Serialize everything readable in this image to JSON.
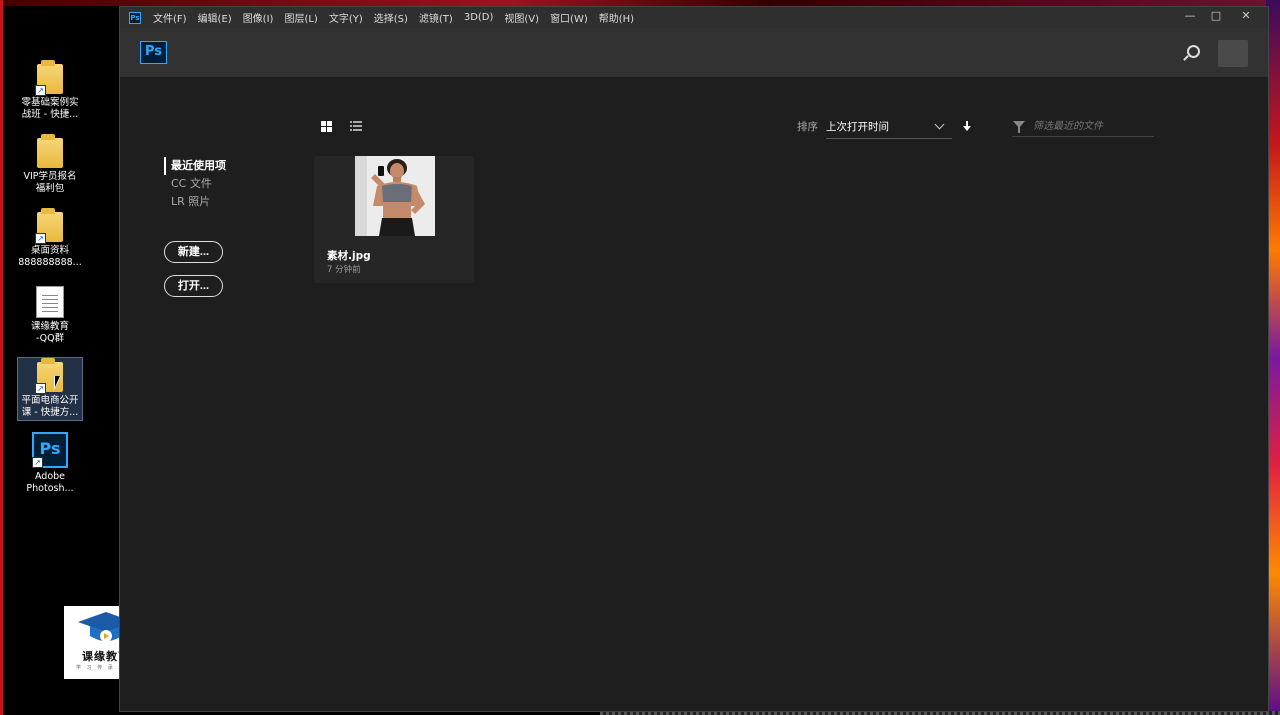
{
  "desktop": {
    "icons": [
      {
        "name": "零基础案例实战班 - 快捷...",
        "line1": "零基础案例实",
        "line2": "战班 - 快捷...",
        "type": "folder",
        "shortcut": true
      },
      {
        "name": "VIP学员报名福利包",
        "line1": "VIP学员报名",
        "line2": "福利包",
        "type": "folder",
        "shortcut": false
      },
      {
        "name": "桌面资料888888888...",
        "line1": "桌面资料",
        "line2": "888888888...",
        "type": "folder",
        "shortcut": true
      },
      {
        "name": "课缘教育-QQ群",
        "line1": "课缘教育",
        "line2": "-QQ群",
        "type": "document",
        "shortcut": false
      },
      {
        "name": "平面电商公开课 - 快捷方...",
        "line1": "平面电商公开",
        "line2": "课 - 快捷方...",
        "type": "folder",
        "shortcut": true,
        "selected": true
      },
      {
        "name": "Adobe Photosh...",
        "line1": "Adobe",
        "line2": "Photosh...",
        "type": "photoshop",
        "shortcut": true
      }
    ],
    "logo": {
      "title": "课缘教育",
      "subtitle": "学 习 传 承 未 来"
    }
  },
  "app": {
    "menu": [
      "文件(F)",
      "编辑(E)",
      "图像(I)",
      "图层(L)",
      "文字(Y)",
      "选择(S)",
      "滤镜(T)",
      "3D(D)",
      "视图(V)",
      "窗口(W)",
      "帮助(H)"
    ],
    "logo_text": "Ps",
    "window_controls": {
      "minimize": "—",
      "maximize": "□",
      "close": "✕"
    },
    "sidebar": {
      "items": [
        "最近使用项",
        "CC 文件",
        "LR 照片"
      ],
      "new_button": "新建...",
      "open_button": "打开..."
    },
    "toolbar": {
      "sort_label": "排序",
      "sort_value": "上次打开时间",
      "filter_placeholder": "筛选最近的文件"
    },
    "recent_files": [
      {
        "name": "素材.jpg",
        "time": "7 分钟前"
      }
    ]
  },
  "icons": [
    "search-icon",
    "grid-view-icon",
    "list-view-icon",
    "chevron-down-icon",
    "sort-direction-icon",
    "filter-icon"
  ],
  "colors": {
    "ps_accent": "#31a8ff",
    "app_bg": "#1e1e1e",
    "topbar_bg": "#323232"
  }
}
